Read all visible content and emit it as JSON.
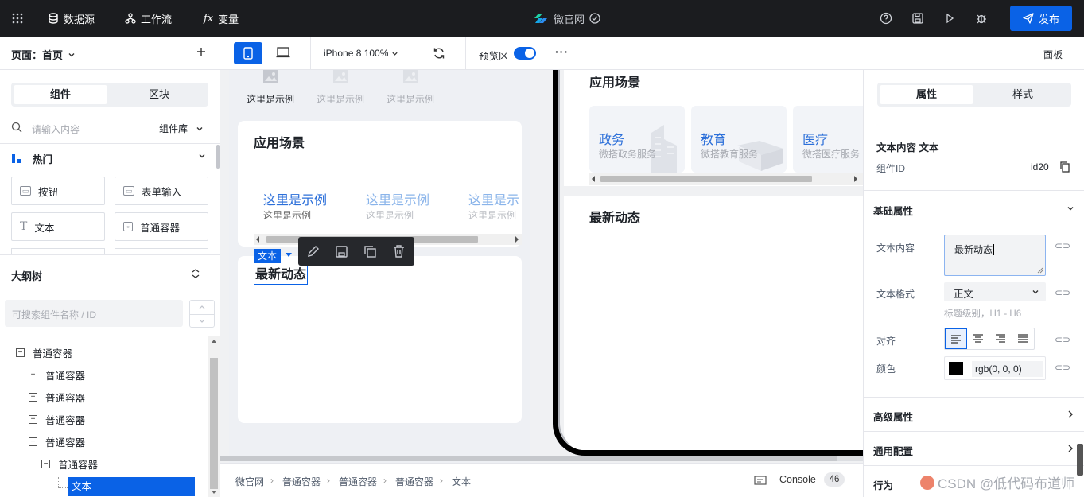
{
  "topbar": {
    "datasource": "数据源",
    "workflow": "工作流",
    "variables": "变量",
    "fx_symbol": "fx",
    "app_name": "微官网",
    "publish": "发布"
  },
  "left": {
    "page_label": "页面：首页",
    "tabs": [
      "组件",
      "区块"
    ],
    "search_placeholder": "请输入内容",
    "library": "组件库",
    "group": "热门",
    "components": [
      "按钮",
      "表单输入",
      "文本",
      "普通容器"
    ],
    "outline_title": "大纲树",
    "outline_search_placeholder": "可搜索组件名称 / ID",
    "tree": [
      {
        "label": "普通容器",
        "toggle": "−"
      },
      {
        "label": "普通容器",
        "toggle": "+"
      },
      {
        "label": "普通容器",
        "toggle": "+"
      },
      {
        "label": "普通容器",
        "toggle": "+"
      },
      {
        "label": "普通容器",
        "toggle": "−"
      },
      {
        "label": "普通容器",
        "toggle": "−"
      },
      {
        "label": "文本",
        "toggle": ""
      }
    ]
  },
  "toolbar": {
    "device": "iPhone 8 100%",
    "preview": "预览区",
    "more": "···",
    "panel": "面板"
  },
  "canvas": {
    "examples_top": [
      "这里是示例",
      "这里是示例",
      "这里是示例"
    ],
    "scene_title": "应用场景",
    "scene_items": [
      {
        "title": "这里是示例",
        "sub": "这里是示例"
      },
      {
        "title": "这里是示例",
        "sub": "这里是示例"
      },
      {
        "title": "这里是示",
        "sub": "这里是示例"
      }
    ],
    "selection_tag": "文本",
    "news_title": "最新动态",
    "preview_scene_title": "应用场景",
    "preview_cards": [
      {
        "title": "政务",
        "sub": "微搭政务服务"
      },
      {
        "title": "教育",
        "sub": "微搭教育服务"
      },
      {
        "title": "医疗",
        "sub": "微搭医疗服务"
      }
    ],
    "preview_news_title": "最新动态"
  },
  "right": {
    "tabs": [
      "属性",
      "样式"
    ],
    "content_heading": "文本内容 文本",
    "component_id_label": "组件ID",
    "component_id": "id20",
    "basic_props": "基础属性",
    "text_content_label": "文本内容",
    "text_content_value": "最新动态",
    "text_format_label": "文本格式",
    "text_format_value": "正文",
    "text_format_hint": "标题级别，H1 - H6",
    "align_label": "对齐",
    "color_label": "颜色",
    "color_value": "rgb(0, 0, 0)",
    "advanced_props": "高级属性",
    "common_config": "通用配置",
    "behavior": "行为"
  },
  "bottom": {
    "breadcrumbs": [
      "微官网",
      "普通容器",
      "普通容器",
      "普通容器",
      "文本"
    ],
    "console": "Console",
    "console_count": "46"
  },
  "watermark": "CSDN @低代码布道师",
  "colors": {
    "accent": "#0a62e6",
    "topbar": "#1b1c1f",
    "link_blue": "#2c6fd9"
  }
}
